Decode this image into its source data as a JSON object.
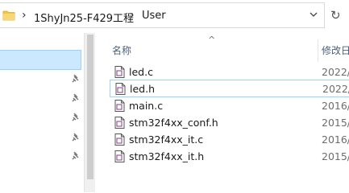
{
  "address_bar": {
    "breadcrumbs": [
      "1ShyJn25-F429工程",
      "User"
    ],
    "separator": "›",
    "folder_icon": "folder-icon",
    "dropdown_icon": "chevron-down-icon",
    "refresh_symbol": "↻"
  },
  "file_list": {
    "columns": {
      "name": "名称",
      "date": "修改日"
    },
    "sort_indicator": "^",
    "files": [
      {
        "name": "led.c",
        "date": "2022/"
      },
      {
        "name": "led.h",
        "date": "2022/"
      },
      {
        "name": "main.c",
        "date": "2016/"
      },
      {
        "name": "stm32f4xx_conf.h",
        "date": "2015/"
      },
      {
        "name": "stm32f4xx_it.c",
        "date": "2016/"
      },
      {
        "name": "stm32f4xx_it.h",
        "date": "2015/"
      }
    ]
  },
  "colors": {
    "selection_bg": "#cce8ff",
    "selection_border": "#99d1ff",
    "folder": "#f3c744"
  }
}
